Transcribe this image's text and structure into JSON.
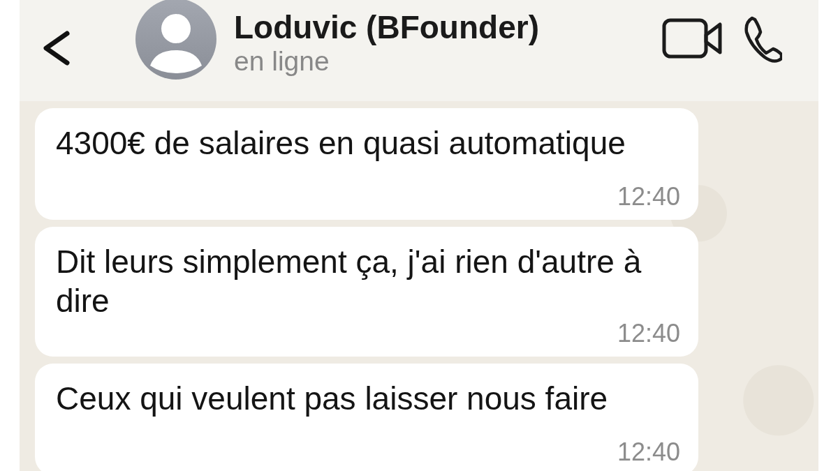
{
  "header": {
    "contact_name": "Loduvic (BFounder)",
    "status": "en ligne"
  },
  "messages": [
    {
      "text": "4300€ de salaires en quasi automatique",
      "time": "12:40"
    },
    {
      "text": "Dit leurs simplement ça, j'ai rien d'autre à dire",
      "time": "12:40"
    },
    {
      "text": "Ceux qui veulent pas laisser nous faire",
      "time": "12:40"
    }
  ]
}
